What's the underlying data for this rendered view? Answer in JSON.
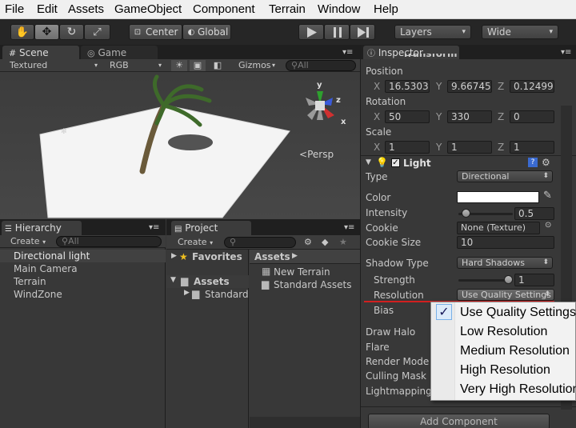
{
  "menubar": [
    "File",
    "Edit",
    "Assets",
    "GameObject",
    "Component",
    "Terrain",
    "Window",
    "Help"
  ],
  "toolbar": {
    "tools": [
      "hand-tool",
      "move-tool",
      "rotate-tool",
      "scale-tool"
    ],
    "pivot": "Center",
    "space": "Global",
    "playback": [
      "play",
      "pause",
      "step"
    ],
    "layers": "Layers",
    "layout": "Wide"
  },
  "scene": {
    "tab": "Scene",
    "tab2": "Game",
    "render_mode": "Textured",
    "color_mode": "RGB",
    "gizmos": "Gizmos",
    "search_placeholder": "All",
    "persp": "Persp",
    "axes": {
      "x": "x",
      "y": "y",
      "z": "z"
    }
  },
  "hierarchy": {
    "tab": "Hierarchy",
    "create": "Create",
    "search_placeholder": "All",
    "items": [
      "Directional light",
      "Main Camera",
      "Terrain",
      "WindZone"
    ]
  },
  "project": {
    "tab": "Project",
    "create": "Create",
    "favorites": "Favorites",
    "assets": "Assets",
    "assets_child": "Standard",
    "breadcrumb": "Assets",
    "files": [
      "New Terrain",
      "Standard Assets"
    ]
  },
  "inspector": {
    "tab": "Inspector",
    "component_title_partial": "Transform",
    "position": {
      "label": "Position",
      "x": "16.53032",
      "y": "9.667452",
      "z": "0.124994"
    },
    "rotation": {
      "label": "Rotation",
      "x": "50",
      "y": "330",
      "z": "0"
    },
    "scale": {
      "label": "Scale",
      "x": "1",
      "y": "1",
      "z": "1"
    },
    "light": {
      "title": "Light",
      "type_label": "Type",
      "type_value": "Directional",
      "color_label": "Color",
      "intensity_label": "Intensity",
      "intensity_value": "0.5",
      "intensity_fraction": 0.0625,
      "cookie_label": "Cookie",
      "cookie_value": "None (Texture)",
      "cookie_size_label": "Cookie Size",
      "cookie_size_value": "10",
      "shadow_type_label": "Shadow Type",
      "shadow_type_value": "Hard Shadows",
      "strength_label": "Strength",
      "strength_value": "1",
      "strength_fraction": 1.0,
      "resolution_label": "Resolution",
      "resolution_value": "Use Quality Settings",
      "bias_label": "Bias",
      "draw_halo_label": "Draw Halo",
      "flare_label": "Flare",
      "render_mode_label": "Render Mode",
      "culling_mask_label": "Culling Mask",
      "lightmapping_label": "Lightmapping"
    },
    "add_component": "Add Component",
    "axis_x": "X",
    "axis_y": "Y",
    "axis_z": "Z"
  },
  "resolution_menu": {
    "options": [
      "Use Quality Settings",
      "Low Resolution",
      "Medium Resolution",
      "High Resolution",
      "Very High Resolution"
    ],
    "selected_index": 0,
    "checkmark": "✓"
  },
  "colors": {
    "accent_underline": "#d21f1f",
    "selection": "#3d6ab0"
  }
}
